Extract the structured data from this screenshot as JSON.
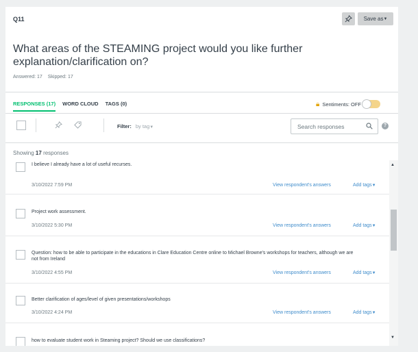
{
  "question": {
    "number": "Q11",
    "text": "What areas of the STEAMING project would you like further explanation/clarification on?",
    "answered": "Answered: 17",
    "skipped": "Skipped: 17"
  },
  "header": {
    "save_as_label": "Save as",
    "pin_icon": "pin-icon"
  },
  "tabs": [
    {
      "label": "RESPONSES (17)",
      "active": true
    },
    {
      "label": "WORD CLOUD",
      "active": false
    },
    {
      "label": "TAGS (0)",
      "active": false
    }
  ],
  "sentiments": {
    "label": "Sentiments: OFF",
    "state": "off",
    "lock_icon": "lock-icon"
  },
  "toolbar": {
    "filter_label": "Filter:",
    "filter_value": "by tag",
    "search_placeholder": "Search responses",
    "help": "?"
  },
  "showing": {
    "prefix": "Showing",
    "count": "17",
    "suffix": "responses"
  },
  "responses": [
    {
      "text": "I believe I already have a lot of useful recurses.",
      "date": "3/10/2022 7:59 PM"
    },
    {
      "text": "Project work assessment.",
      "date": "3/10/2022 5:30 PM"
    },
    {
      "text": "Question: how to be able to participate in the educations in Clare Education Centre online to Michael Browne's workshops for teachers, although we are not from Ireland",
      "date": "3/10/2022 4:55 PM"
    },
    {
      "text": "Better clarification of ages/level of given presentations/workshops",
      "date": "3/10/2022 4:24 PM"
    },
    {
      "text": "how to evaluate student work in Steaming project? Should we use classifications?",
      "date": ""
    }
  ],
  "response_actions": {
    "view_label": "View respondent's answers",
    "add_tags_label": "Add tags"
  },
  "colors": {
    "accent": "#00bf6f",
    "link": "#3f8ccb",
    "button_bg": "#d0d2d3"
  }
}
